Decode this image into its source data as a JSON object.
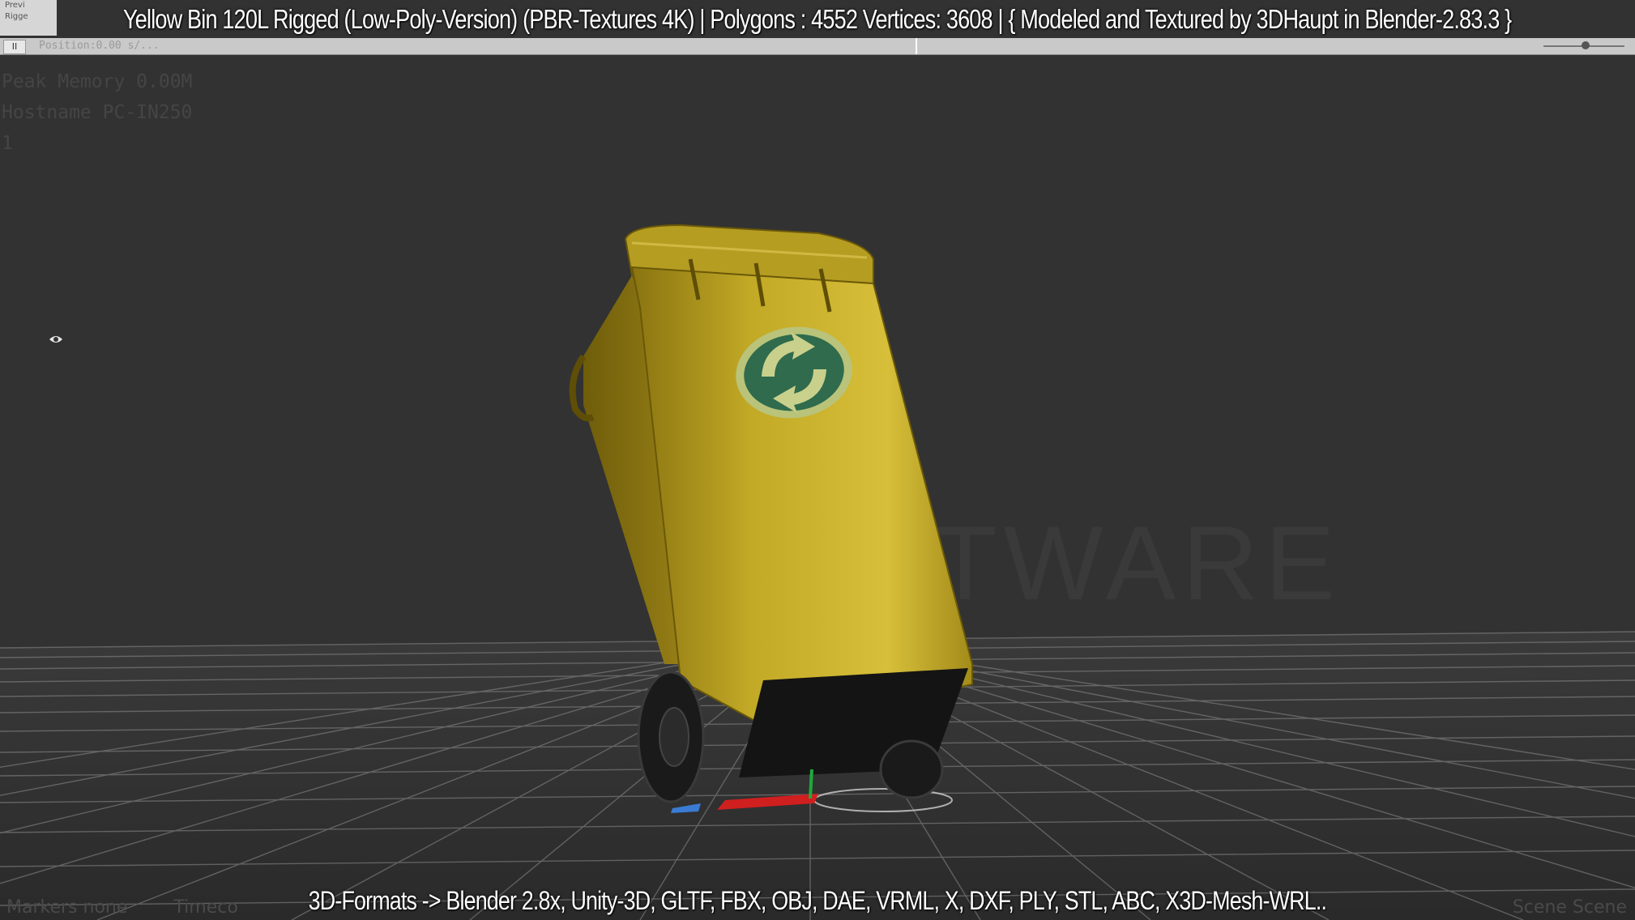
{
  "title": "Yellow Bin 120L Rigged (Low-Poly-Version)  (PBR-Textures 4K) | Polygons : 4552  Vertices: 3608  | { Modeled and Textured by 3DHaupt in Blender-2.83.3 }",
  "corner_tab": [
    "Previ",
    "Rigge"
  ],
  "timeline": {
    "pause_glyph": "II",
    "label": "Position:0.00 s/..."
  },
  "stats": [
    "Peak Memory 0.00M",
    "Hostname PC-IN250",
    "1"
  ],
  "watermark": "SOFTWARE",
  "caption": "3D-Formats -> Blender 2.8x, Unity-3D, GLTF, FBX, OBJ, DAE, VRML, X, DXF, PLY, STL, ABC, X3D-Mesh-WRL..",
  "bottom_left": [
    "Markers none",
    "Timeco"
  ],
  "bottom_right": "Scene Scene",
  "colors": {
    "background": "#323232",
    "bin_yellow": "#c2a926",
    "bin_dark": "#8a7410",
    "logo_green": "#2f6b4c",
    "grid": "#9a9a9a"
  },
  "icons": {
    "visibility": "eye-icon",
    "pause": "pause-icon"
  }
}
